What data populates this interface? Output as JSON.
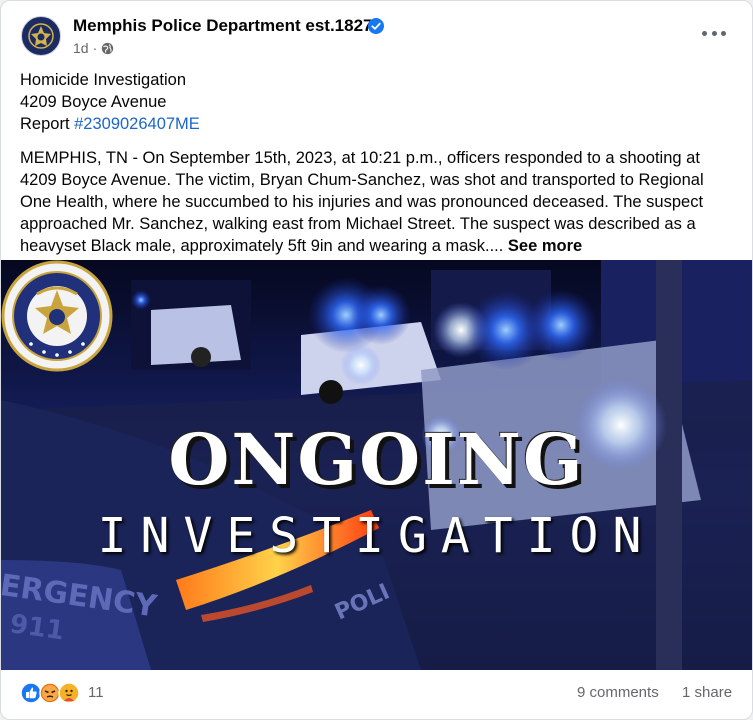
{
  "post": {
    "page_name": "Memphis Police Department est.1827",
    "timestamp": "1d",
    "meta_separator": "·",
    "title_lines": [
      "Homicide Investigation",
      "4209 Boyce Avenue"
    ],
    "report_prefix": "Report ",
    "report_hashtag": "#2309026407ME",
    "body_lines": [
      "MEMPHIS, TN - On September 15th, 2023, at 10:21 p.m., officers responded to a shooting at",
      "4209 Boyce Avenue. The victim, Bryan Chum-Sanchez, was shot and transported to Regional",
      "One Health, where he succumbed to his injuries and was pronounced deceased. The suspect",
      "approached Mr. Sanchez, walking east from Michael Street. The suspect was described as a"
    ],
    "last_line": "heavyset Black male, approximately 5ft 9in and wearing a mask.... ",
    "see_more": "See more"
  },
  "image": {
    "headline": "ONGOING",
    "subheadline": "INVESTIGATION",
    "seal_text": "SEAL of the MEMPHIS POLICE DEPARTMENT",
    "car_text_1": "ERGENCY",
    "car_text_2": "911",
    "car_text_3": "POLI"
  },
  "footer": {
    "reaction_count": "11",
    "comments": "9 comments",
    "shares": "1 share"
  },
  "icons": {
    "verified": "verified-badge-icon",
    "globe": "globe-icon",
    "more": "more-options-icon",
    "reactions": [
      "like-icon",
      "angry-icon",
      "care-icon"
    ]
  },
  "colors": {
    "accent": "#1b66c9",
    "verified": "#1877f2",
    "secondary_text": "#65676b",
    "like": "#1877f2",
    "angry": "#e9710f",
    "care": "#f7b125"
  }
}
